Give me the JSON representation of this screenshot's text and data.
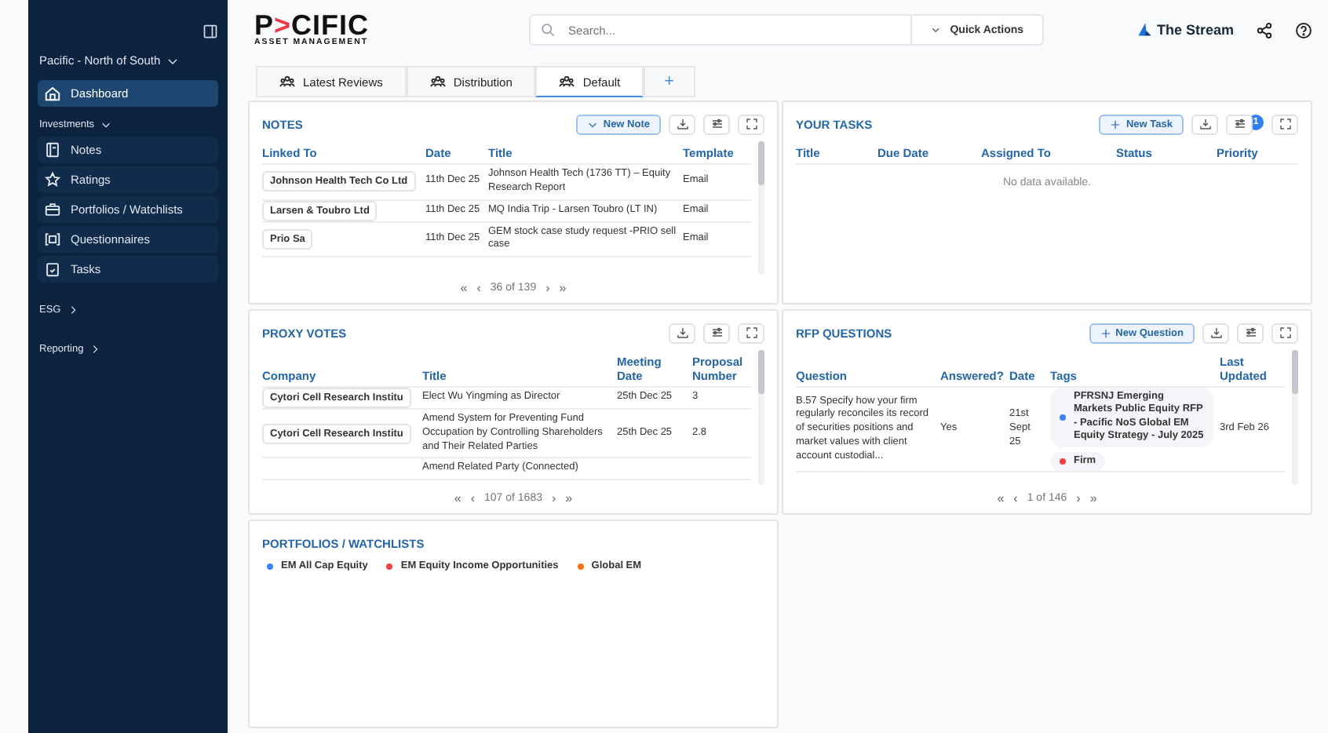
{
  "sidebar": {
    "workspace": "Pacific - North of South",
    "items": [
      {
        "kind": "link",
        "label": "Dashboard",
        "selected": true
      },
      {
        "kind": "section",
        "label": "Investments",
        "expanded": true,
        "children": [
          {
            "label": "Notes",
            "selected": false
          },
          {
            "label": "Ratings",
            "selected": false
          },
          {
            "label": "Portfolios / Watchlists",
            "selected": false
          },
          {
            "label": "Questionnaires",
            "selected": false
          },
          {
            "label": "Tasks",
            "selected": false
          }
        ]
      },
      {
        "kind": "section",
        "label": "ESG",
        "expanded": false
      },
      {
        "kind": "section",
        "label": "Reporting",
        "expanded": false
      }
    ]
  },
  "header": {
    "logo": {
      "lead": "P",
      "mark": ">",
      "rest": "CIFIC",
      "subtitle": "ASSET MANAGEMENT"
    },
    "search": {
      "placeholder": "Search..."
    },
    "quick_actions": "Quick Actions",
    "stream": "The Stream"
  },
  "tabs": [
    {
      "label": "Latest Reviews",
      "selected": false
    },
    {
      "label": "Distribution",
      "selected": false
    },
    {
      "label": "Default",
      "selected": true
    }
  ],
  "add_tab": "+",
  "panels": [
    {
      "kind": "table",
      "title": "NOTES",
      "new_button": {
        "kind": "dropdown",
        "label": "New Note"
      },
      "columns": [
        "Linked To",
        "Date",
        "Title",
        "Template"
      ],
      "rows": [
        {
          "cells": [
            "Johnson Health Tech Co Ltd",
            "11th Dec 25",
            "Johnson Health Tech (1736 TT) – Equity Research Report",
            "Email"
          ]
        },
        {
          "cells": [
            "Larsen & Toubro Ltd",
            "11th Dec 25",
            "MQ India Trip - Larsen Toubro (LT IN)",
            "Email"
          ]
        },
        {
          "cells": [
            "Prio Sa",
            "11th Dec 25",
            "GEM stock case study request -PRIO sell case",
            "Email"
          ]
        }
      ],
      "pager": {
        "first": "«",
        "prev": "‹",
        "label": "36 of 139",
        "next": "›",
        "last": "»"
      }
    },
    {
      "kind": "table",
      "title": "YOUR TASKS",
      "new_button": {
        "kind": "add",
        "label": "New Task"
      },
      "filter_badge": "1",
      "columns": [
        "Title",
        "Due Date",
        "Assigned To",
        "Status",
        "Priority"
      ],
      "empty": "No data available."
    },
    {
      "kind": "table",
      "title": "PROXY VOTES",
      "columns": [
        "Company",
        "Title",
        "Meeting Date",
        "Proposal Number"
      ],
      "rows": [
        {
          "cells": [
            "Cytori Cell Research Institu",
            "Elect Wu Yingming as Director",
            "25th Dec 25",
            "3"
          ]
        },
        {
          "cells": [
            "Cytori Cell Research Institu",
            "Amend System for Preventing Fund Occupation by Controlling Shareholders and Their Related Parties",
            "25th Dec 25",
            "2.8"
          ]
        },
        {
          "cells": [
            "",
            "Amend Related Party (Connected)",
            "",
            ""
          ]
        }
      ],
      "pager": {
        "first": "«",
        "prev": "‹",
        "label": "107 of 1683",
        "next": "›",
        "last": "»"
      }
    },
    {
      "kind": "table",
      "title": "RFP QUESTIONS",
      "new_button": {
        "kind": "add",
        "label": "New Question"
      },
      "columns": [
        "Question",
        "Answered?",
        "Date",
        "Tags",
        "Last Updated"
      ],
      "rows": [
        {
          "cells": [
            "B.57 Specify how your firm regularly reconciles its record of securities positions and market values with client account custodial...",
            "Yes",
            "21st Sept 25",
            "",
            "3rd Feb 26"
          ],
          "tags": [
            {
              "label": "PFRSNJ Emerging Markets Public Equity RFP - Pacific NoS Global EM Equity Strategy - July 2025",
              "color": "#3b82f6"
            },
            {
              "label": "Firm",
              "color": "#ef4444"
            }
          ]
        }
      ],
      "pager": {
        "first": "«",
        "prev": "‹",
        "label": "1 of 146",
        "next": "›",
        "last": "»"
      }
    },
    {
      "kind": "legend",
      "title": "PORTFOLIOS / WATCHLISTS",
      "items": [
        {
          "label": "EM All Cap Equity",
          "color": "#3b82f6"
        },
        {
          "label": "EM Equity Income Opportunities",
          "color": "#ef4444"
        },
        {
          "label": "Global EM",
          "color": "#f97316"
        }
      ]
    }
  ]
}
